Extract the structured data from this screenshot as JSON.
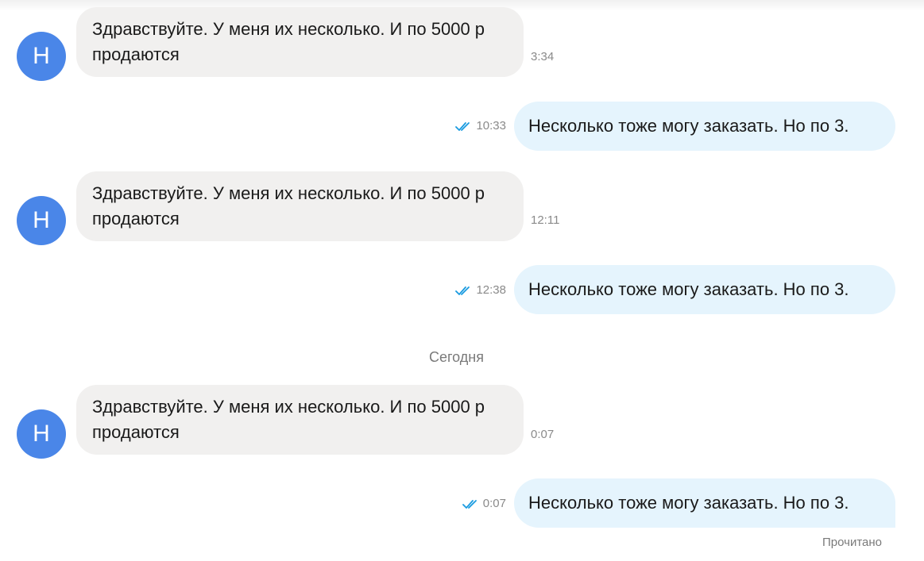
{
  "messages": [
    {
      "direction": "in",
      "avatar_letter": "Н",
      "text": "Здравствуйте. У меня их несколько. И по 5000 р продаются",
      "time": "3:34"
    },
    {
      "direction": "out",
      "text": "Несколько тоже могу заказать. Но по 3.",
      "time": "10:33",
      "status_icon": "double-check-icon"
    },
    {
      "direction": "in",
      "avatar_letter": "Н",
      "text": "Здравствуйте. У меня их несколько. И по 5000 р продаются",
      "time": "12:11"
    },
    {
      "direction": "out",
      "text": "Несколько тоже могу заказать. Но по 3.",
      "time": "12:38",
      "status_icon": "double-check-icon"
    },
    {
      "direction": "in",
      "avatar_letter": "Н",
      "text": "Здравствуйте. У меня их несколько. И по 5000 р продаются",
      "time": "0:07"
    },
    {
      "direction": "out",
      "text": "Несколько тоже могу заказать. Но по 3.",
      "time": "0:07",
      "status_icon": "double-check-icon"
    }
  ],
  "date_divider": "Сегодня",
  "read_status": "Прочитано",
  "colors": {
    "avatar": "#4a86e8",
    "incoming_bubble": "#f1f0ef",
    "outgoing_bubble": "#e5f4fd",
    "check": "#1a9be0"
  }
}
